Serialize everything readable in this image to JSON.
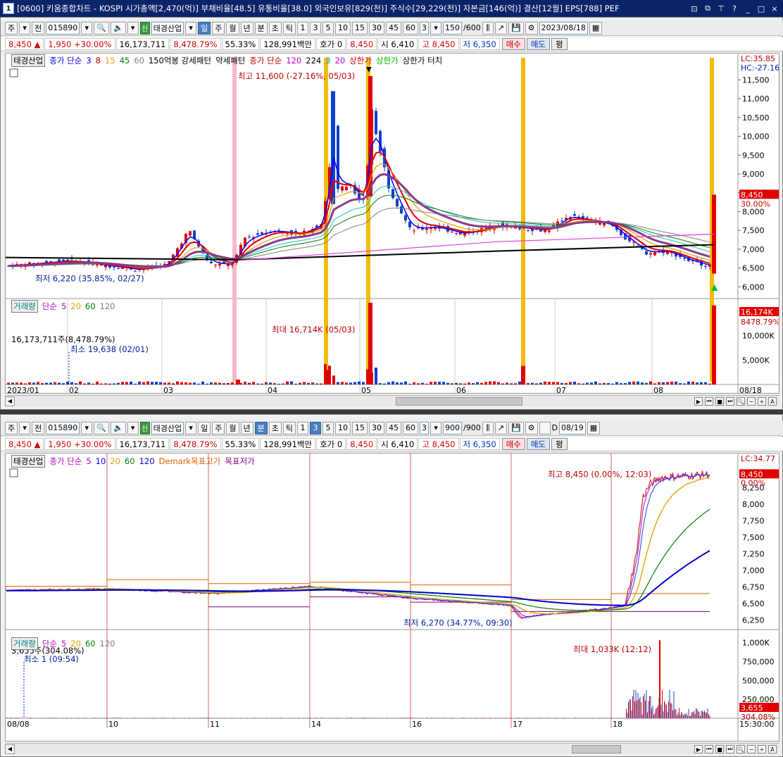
{
  "titlebar": {
    "num": "1",
    "title": "[0600] 키움종합차트 - KOSPI 시가총액[2,470(억)] 부채비율[48.5] 유통비율[38.0] 외국인보유[829(천)] 주식수[29,229(천)] 자본금[146(억)] 결산[12월] EPS[788] PEF",
    "ctrl_icons": [
      "window-icon",
      "restore-icon",
      "pin-icon",
      "help-icon",
      "minimize-icon",
      "maximize-icon",
      "close-icon"
    ],
    "ctrls": [
      "⊡",
      "⧉",
      "⊤",
      "?",
      "_",
      "□",
      "×"
    ]
  },
  "top": {
    "toolbar": {
      "market": "주",
      "all": "전",
      "code": "015890",
      "name_badge": "신",
      "name": "태경산업",
      "periods": [
        "일",
        "주",
        "월",
        "년",
        "분",
        "초",
        "틱"
      ],
      "minutes": [
        "1",
        "3",
        "5",
        "10",
        "15",
        "30",
        "45",
        "60"
      ],
      "count": "3",
      "range": "150",
      "range_total": "/600",
      "date": "2023/08/18"
    },
    "quote": {
      "price": "8,450",
      "arrow": "▲",
      "change": "1,950",
      "pct": "+30.00%",
      "volume": "16,173,711",
      "vol_ratio": "8,478.79%",
      "turnover": "55.33%",
      "amount": "128,991백만",
      "hoga_label": "호가",
      "hoga_val": "0",
      "ask": "8,450",
      "open_label": "시",
      "open": "6,410",
      "high_label": "고",
      "high": "8,450",
      "low_label": "저",
      "low": "6,350",
      "buy": "매수",
      "sell": "매도",
      "eval": "평"
    },
    "legend": {
      "items": [
        "태경산업",
        "종가 단순",
        "3",
        "8",
        "15",
        "45",
        "60",
        "150억봉 강세패턴",
        "약세패턴",
        "종가 단순",
        "120",
        "224",
        "3",
        "20",
        "상한가",
        "상한가",
        "상한가 터치"
      ],
      "colors": [
        "#000000",
        "#0000ff",
        "#0000ff",
        "#c00000",
        "#e0a000",
        "#008000",
        "#808080",
        "#000000",
        "#000000",
        "#c00000",
        "#c000c0",
        "#000000",
        "#00a0a0",
        "#c000c0",
        "#d00000",
        "#00b000",
        "#000000"
      ]
    },
    "vol_legend": {
      "items": [
        "거래량",
        "단순",
        "5",
        "20",
        "60",
        "120"
      ],
      "colors": [
        "#008080",
        "#c000c0",
        "#c000c0",
        "#e0a000",
        "#008000",
        "#808080"
      ],
      "sub": "16,173,711주(8,478.79%)",
      "min": "최소 19,638 (02/01)"
    },
    "labels": {
      "lc": "LC:35.85",
      "hc": "HC:-27.16",
      "high_note": "최고 11,600 (-27.16%, 05/03)",
      "low_note": "최저 6,220 (35.85%, 02/27)",
      "price_tag": "8,450",
      "price_pct": "30.00%",
      "vol_note": "최대 16,714K (05/03)",
      "vol_tag": "16,174K",
      "vol_pct": "8478.79%"
    },
    "yaxis": [
      "11,500",
      "11,000",
      "10,500",
      "10,000",
      "9,500",
      "9,000",
      "8,500",
      "8,000",
      "7,500",
      "7,000",
      "6,500",
      "6,000"
    ],
    "yvals": [
      11500,
      11000,
      10500,
      10000,
      9500,
      9000,
      8500,
      8000,
      7500,
      7000,
      6500,
      6000
    ],
    "vol_axis": [
      "10,000K",
      "5,000K"
    ],
    "vol_axis_vals": [
      10000,
      5000
    ],
    "xaxis": [
      "2023/01",
      "02",
      "03",
      "04",
      "05",
      "06",
      "07",
      "08",
      "08/18"
    ]
  },
  "bottom": {
    "toolbar": {
      "market": "주",
      "all": "전",
      "code": "015890",
      "name_badge": "신",
      "name": "태경산업",
      "periods": [
        "일",
        "주",
        "월",
        "년",
        "분",
        "초",
        "틱"
      ],
      "minutes": [
        "1",
        "3",
        "5",
        "10",
        "15",
        "30",
        "45",
        "60"
      ],
      "count": "3",
      "range": "900",
      "range_total": "/900",
      "d_label": "D",
      "date": "08/19"
    },
    "quote": {
      "price": "8,450",
      "arrow": "▲",
      "change": "1,950",
      "pct": "+30.00%",
      "volume": "16,173,711",
      "vol_ratio": "8,478.79%",
      "turnover": "55.33%",
      "amount": "128,991백만",
      "hoga_label": "호가",
      "hoga_val": "0",
      "ask": "8,450",
      "open_label": "시",
      "open": "6,410",
      "high_label": "고",
      "high": "8,450",
      "low_label": "저",
      "low": "6,350",
      "buy": "매수",
      "sell": "매도",
      "eval": "평"
    },
    "legend": {
      "items": [
        "태경산업",
        "종가 단순",
        "5",
        "10",
        "20",
        "60",
        "120",
        "Demark목표고가",
        "목표저가"
      ],
      "colors": [
        "#000000",
        "#c000c0",
        "#c000c0",
        "#0000ff",
        "#e0a000",
        "#008000",
        "#0000cc",
        "#e06000",
        "#800080"
      ]
    },
    "vol_legend": {
      "items": [
        "거래량",
        "단순",
        "5",
        "20",
        "60",
        "120"
      ],
      "colors": [
        "#008080",
        "#c000c0",
        "#c000c0",
        "#e0a000",
        "#008000",
        "#808080"
      ],
      "sub": "3,655주(304.08%)",
      "min": "최소 1 (09:54)"
    },
    "labels": {
      "lc": "LC:34.77",
      "high_note": "최고 8,450 (0.00%, 12:03)",
      "low_note": "최저 6,270 (34.77%, 09:30)",
      "price_tag": "8,450",
      "price_pct": "0.00%",
      "vol_note": "최대 1,033K (12:12)",
      "vol_tag": "3,655",
      "vol_pct": "304.08%"
    },
    "yaxis": [
      "8,250",
      "8,000",
      "7,750",
      "7,500",
      "7,250",
      "7,000",
      "6,750",
      "6,500",
      "6,250"
    ],
    "yvals": [
      8250,
      8000,
      7750,
      7500,
      7250,
      7000,
      6750,
      6500,
      6250
    ],
    "vol_axis": [
      "1,000K",
      "750,000",
      "500,000",
      "250,000"
    ],
    "vol_axis_vals": [
      1000,
      750,
      500,
      250
    ],
    "xaxis": [
      "08/08",
      "10",
      "11",
      "14",
      "16",
      "17",
      "18",
      "15:30:00"
    ]
  },
  "chart_data": [
    {
      "type": "candlestick",
      "title": "태경산업 일봉",
      "x": [
        "2023/01",
        "02",
        "03",
        "04",
        "05",
        "06",
        "07",
        "08"
      ],
      "ylim": [
        6000,
        11800
      ],
      "highlights": {
        "max": 11600,
        "min": 6220,
        "last": 8450
      },
      "close_approx": [
        6500,
        6600,
        6700,
        7000,
        9600,
        7500,
        7600,
        6800,
        8450
      ]
    },
    {
      "type": "candlestick",
      "title": "태경산업 3분봉",
      "x": [
        "08/08",
        "10",
        "11",
        "14",
        "16",
        "17",
        "18"
      ],
      "ylim": [
        6200,
        8500
      ],
      "highlights": {
        "max": 8450,
        "min": 6270,
        "last": 8450
      }
    }
  ]
}
